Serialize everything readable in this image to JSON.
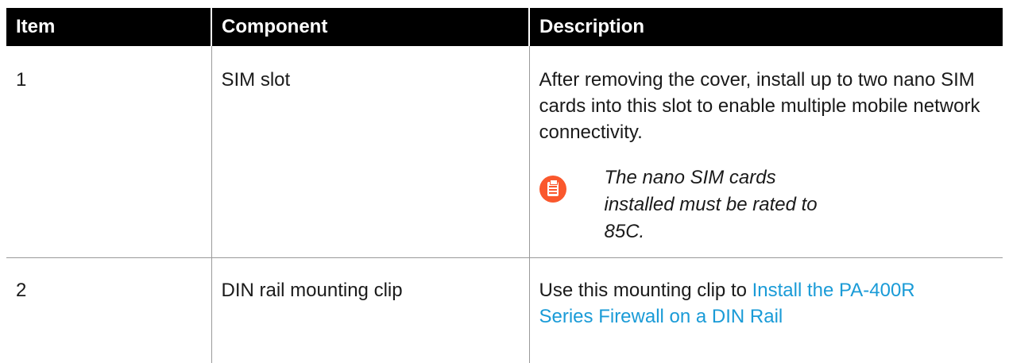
{
  "table": {
    "headers": {
      "item": "Item",
      "component": "Component",
      "description": "Description"
    },
    "rows": [
      {
        "item": "1",
        "component": "SIM slot",
        "description": "After removing the cover, install up to two nano SIM cards into this slot to enable multiple mobile network connectivity.",
        "note": {
          "icon": "note-clipboard-icon",
          "text": "The nano SIM cards installed must be rated to 85C."
        }
      },
      {
        "item": "2",
        "component": "DIN rail mounting clip",
        "description_prefix": "Use this mounting clip to ",
        "description_link": "Install the PA-400R Series Firewall on a DIN Rail"
      }
    ]
  },
  "colors": {
    "header_bg": "#000000",
    "header_text": "#ffffff",
    "link": "#1a9bd7",
    "note_icon": "#fa582d",
    "rule": "#9a9a9a"
  }
}
